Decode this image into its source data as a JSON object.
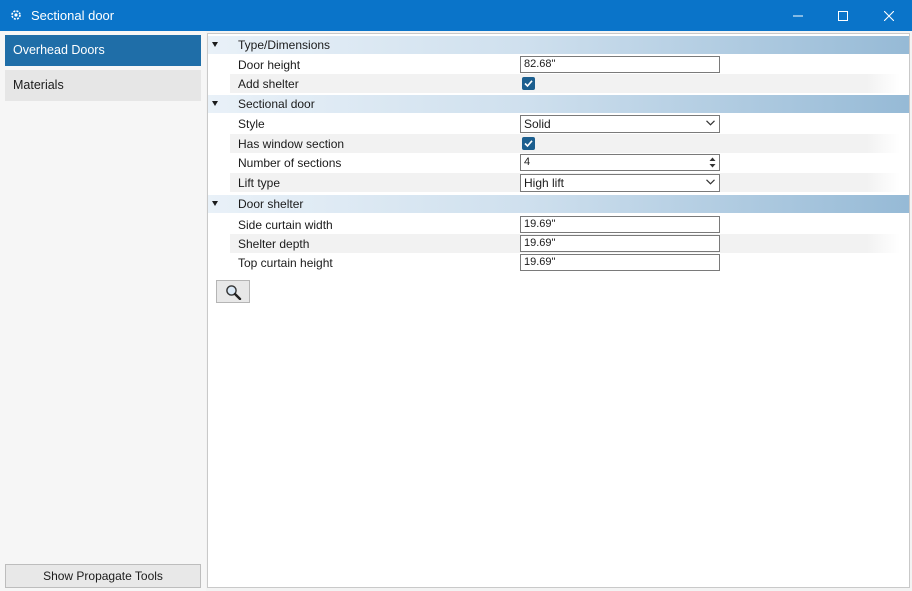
{
  "window": {
    "title": "Sectional door",
    "icon": "gear-icon",
    "accent_color": "#0a74c9"
  },
  "sidebar": {
    "items": [
      {
        "label": "Overhead Doors",
        "selected": true
      },
      {
        "label": "Materials",
        "selected": false
      }
    ],
    "propagate_label": "Show Propagate Tools"
  },
  "sections": {
    "type_dimensions": {
      "label": "Type/Dimensions",
      "door_height": {
        "label": "Door height",
        "value": "82.68\""
      },
      "add_shelter": {
        "label": "Add shelter",
        "checked": true
      }
    },
    "sectional_door": {
      "label": "Sectional door",
      "style": {
        "label": "Style",
        "value": "Solid"
      },
      "has_window_section": {
        "label": "Has window section",
        "checked": true
      },
      "number_of_sections": {
        "label": "Number of sections",
        "value": "4"
      },
      "lift_type": {
        "label": "Lift type",
        "value": "High lift"
      }
    },
    "door_shelter": {
      "label": "Door shelter",
      "side_curtain_width": {
        "label": "Side curtain width",
        "value": "19.69\""
      },
      "shelter_depth": {
        "label": "Shelter depth",
        "value": "19.69\""
      },
      "top_curtain_height": {
        "label": "Top curtain height",
        "value": "19.69\""
      }
    }
  },
  "tools": {
    "search_icon": "magnifier-icon"
  }
}
